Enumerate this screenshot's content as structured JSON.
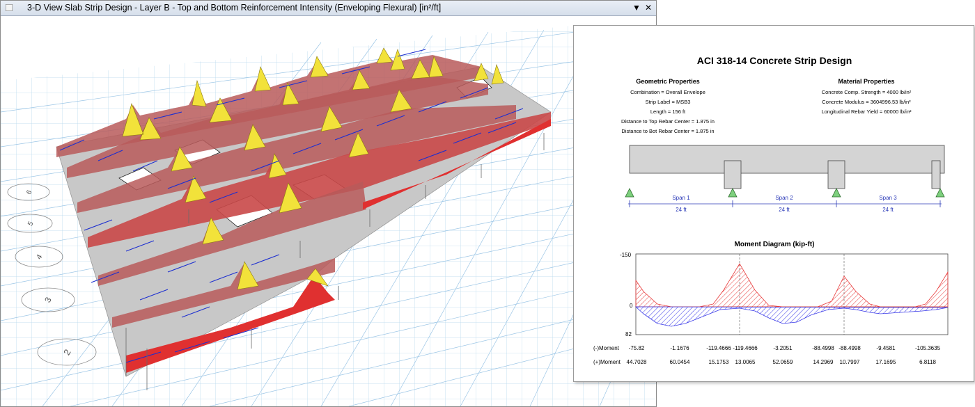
{
  "window": {
    "title": "3-D View  Slab Strip Design - Layer B - Top and Bottom Reinforcement Intensity (Enveloping Flexural) [in²/ft]",
    "dropdown_glyph": "▼",
    "close_glyph": "✕",
    "icon": "view-icon"
  },
  "grid_bubbles": [
    "6",
    "5",
    "4",
    "3",
    "2"
  ],
  "report": {
    "title": "ACI 318-14 Concrete Strip Design",
    "geometric": {
      "heading": "Geometric Properties",
      "lines": [
        "Combination = Overall Envelope",
        "Strip Label = MSB3",
        "Length = 156 ft",
        "Distance to Top Rebar Center = 1.875 in",
        "Distance to Bot Rebar Center = 1.875 in"
      ]
    },
    "material": {
      "heading": "Material Properties",
      "lines": [
        "Concrete Comp. Strength = 4000 lb/in²",
        "Concrete Modulus = 3604996.53 lb/in²",
        "Longitudinal Rebar Yield = 60000 lb/in²"
      ]
    },
    "spans": [
      {
        "name": "Span 1",
        "length": "24 ft"
      },
      {
        "name": "Span 2",
        "length": "24 ft"
      },
      {
        "name": "Span 3",
        "length": "24 ft"
      }
    ],
    "moment_diagram": {
      "title": "Moment Diagram (kip-ft)",
      "y_top": "-150",
      "y_zero": "0",
      "y_bottom": "82",
      "neg_label": "(-)Moment",
      "pos_label": "(+)Moment",
      "neg_values": [
        "-75.82",
        "-1.1676",
        "-119.4666",
        "-119.4666",
        "-3.2051",
        "-88.4998",
        "-88.4998",
        "-9.4581",
        "-105.3635"
      ],
      "pos_values": [
        "44.7028",
        "60.0454",
        "15.1753",
        "13.0065",
        "52.0659",
        "14.2969",
        "10.7997",
        "17.1695",
        "6.8118"
      ],
      "colors": {
        "negative": "#e83a3a",
        "positive": "#3a3ae8"
      }
    }
  }
}
